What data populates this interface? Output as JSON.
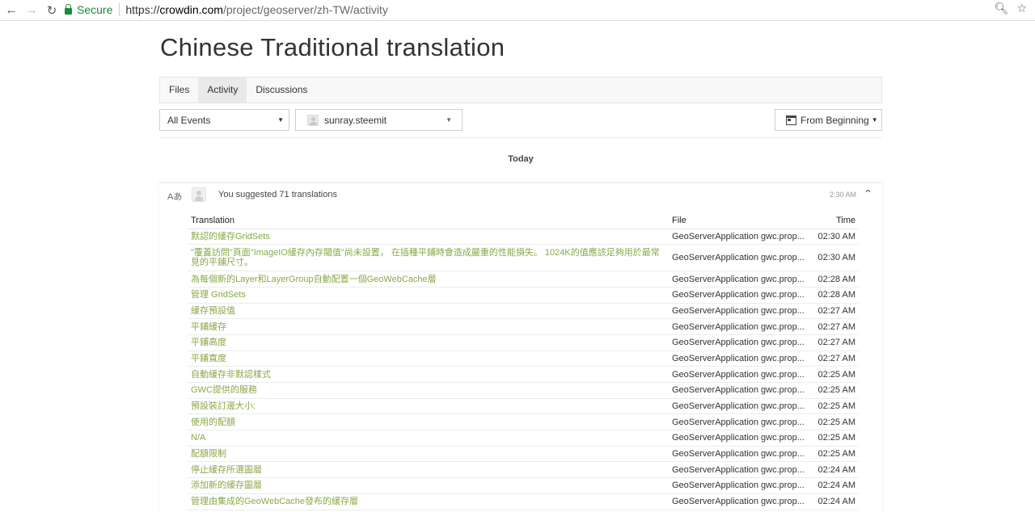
{
  "browser": {
    "secure_label": "Secure",
    "url_scheme": "https://",
    "url_host": "crowdin.com",
    "url_path": "/project/geoserver/zh-TW/activity"
  },
  "page": {
    "title": "Chinese Traditional translation"
  },
  "tabs": [
    {
      "label": "Files",
      "active": false
    },
    {
      "label": "Activity",
      "active": true
    },
    {
      "label": "Discussions",
      "active": false
    }
  ],
  "filters": {
    "events_value": "All Events",
    "user_value": "sunray.steemit",
    "from_label": "From Beginning"
  },
  "day_label": "Today",
  "activity": {
    "summary": "You suggested 71 translations",
    "time": "2:30 AM",
    "columns": {
      "translation": "Translation",
      "file": "File",
      "time": "Time"
    },
    "rows": [
      {
        "translation": "默認的緩存GridSets",
        "file": "GeoServerApplication gwc.prop...",
        "time": "02:30 AM"
      },
      {
        "translation": "\"覆蓋訪問\"頁面\"ImageIO緩存內存閾值\"尚未設置， 在插種平鋪時會造成嚴重的性能損失。 1024K的值應該足夠用於最常見的平鋪尺寸。",
        "file": "GeoServerApplication gwc.prop...",
        "time": "02:30 AM"
      },
      {
        "translation": "為每個新的Layer和LayerGroup自動配置一個GeoWebCache層",
        "file": "GeoServerApplication gwc.prop...",
        "time": "02:28 AM"
      },
      {
        "translation": "管理 GridSets",
        "file": "GeoServerApplication gwc.prop...",
        "time": "02:28 AM"
      },
      {
        "translation": "緩存預設值",
        "file": "GeoServerApplication gwc.prop...",
        "time": "02:27 AM"
      },
      {
        "translation": "平鋪緩存",
        "file": "GeoServerApplication gwc.prop...",
        "time": "02:27 AM"
      },
      {
        "translation": "平鋪高度",
        "file": "GeoServerApplication gwc.prop...",
        "time": "02:27 AM"
      },
      {
        "translation": "平鋪寬度",
        "file": "GeoServerApplication gwc.prop...",
        "time": "02:27 AM"
      },
      {
        "translation": "自動緩存非默認樣式",
        "file": "GeoServerApplication gwc.prop...",
        "time": "02:25 AM"
      },
      {
        "translation": "GWC提供的服務",
        "file": "GeoServerApplication gwc.prop...",
        "time": "02:25 AM"
      },
      {
        "translation": "預設裝訂邊大小:",
        "file": "GeoServerApplication gwc.prop...",
        "time": "02:25 AM"
      },
      {
        "translation": "使用的配額",
        "file": "GeoServerApplication gwc.prop...",
        "time": "02:25 AM"
      },
      {
        "translation": "N/A",
        "file": "GeoServerApplication gwc.prop...",
        "time": "02:25 AM"
      },
      {
        "translation": "配額限制",
        "file": "GeoServerApplication gwc.prop...",
        "time": "02:25 AM"
      },
      {
        "translation": "停止緩存所選圖層",
        "file": "GeoServerApplication gwc.prop...",
        "time": "02:24 AM"
      },
      {
        "translation": "添加新的緩存圖層",
        "file": "GeoServerApplication gwc.prop...",
        "time": "02:24 AM"
      },
      {
        "translation": "管理由集成的GeoWebCache發布的緩存層",
        "file": "GeoServerApplication gwc.prop...",
        "time": "02:24 AM"
      }
    ]
  }
}
